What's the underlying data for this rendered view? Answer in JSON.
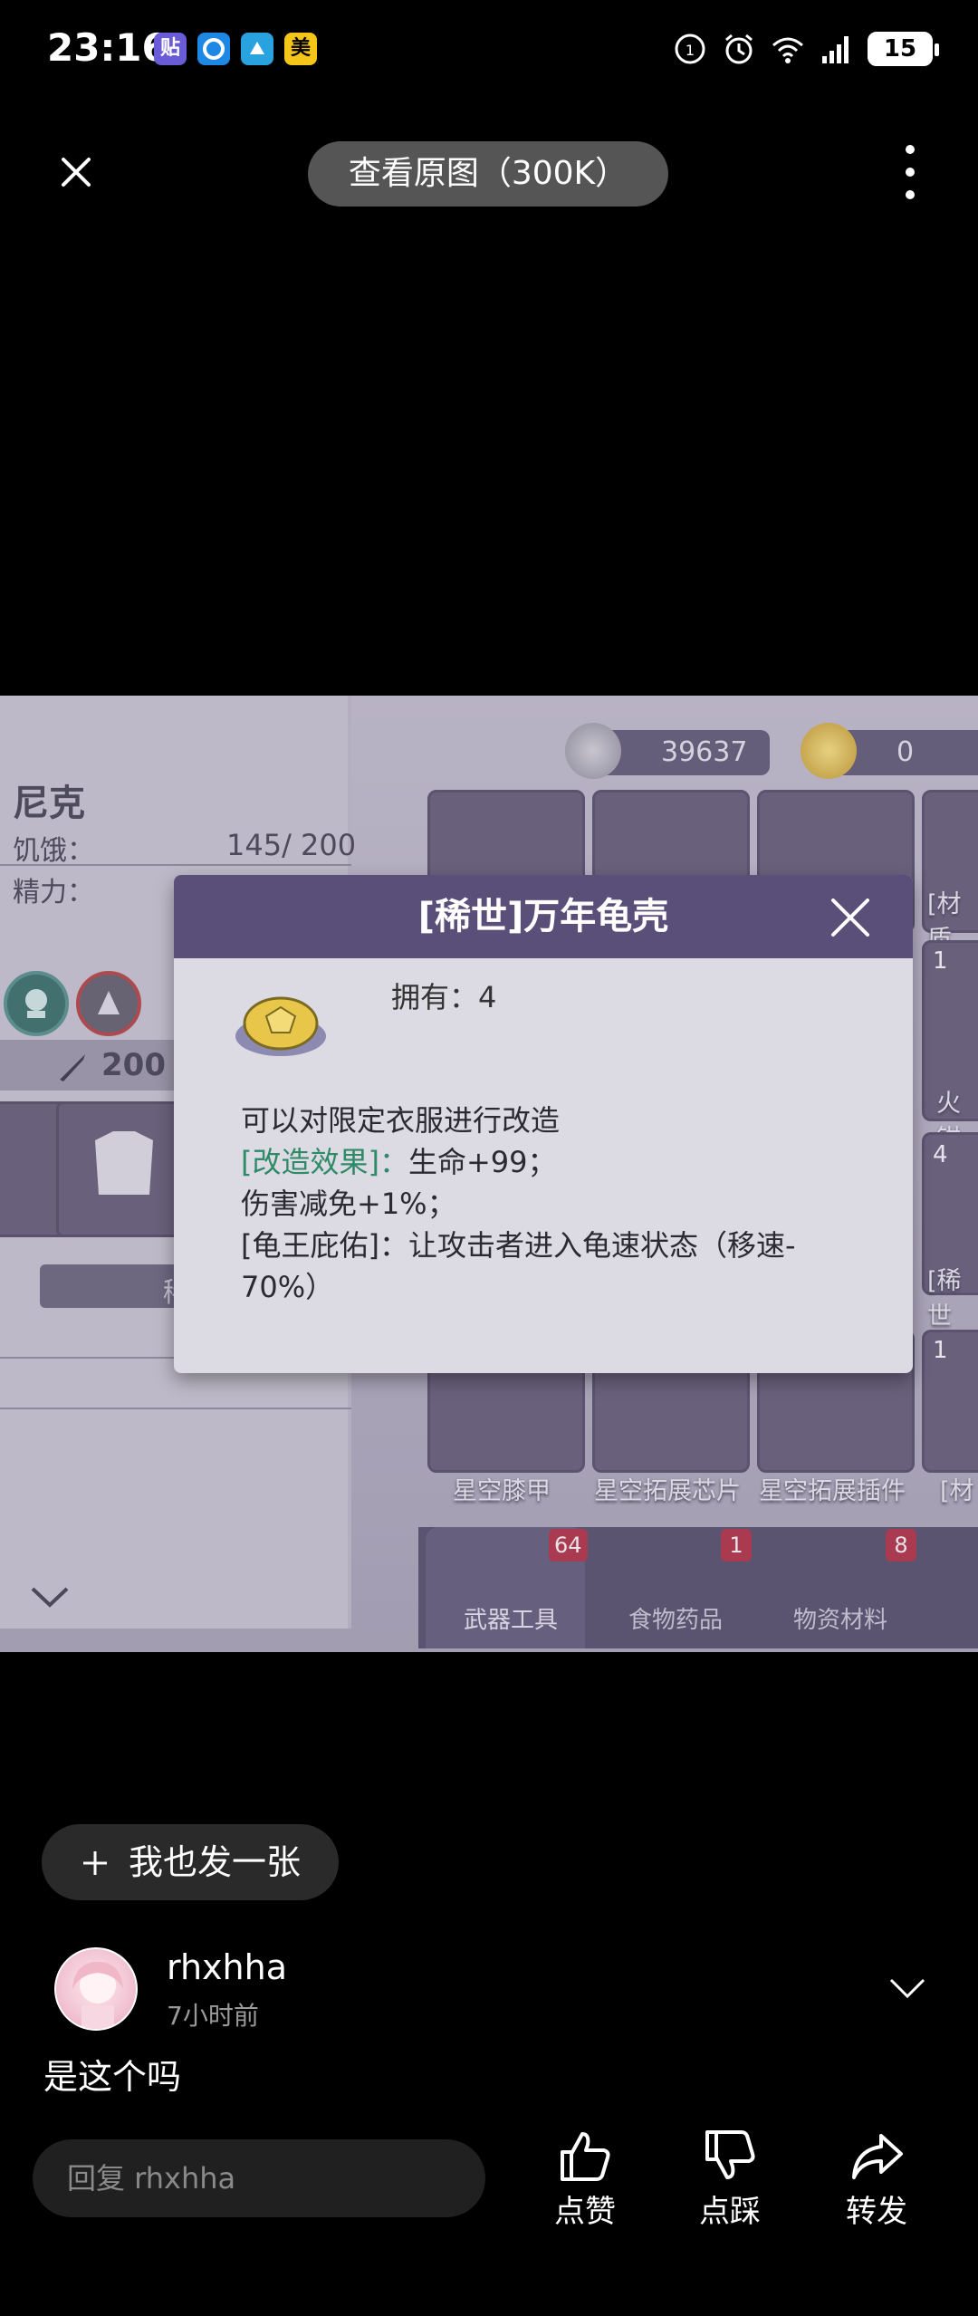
{
  "status_bar": {
    "time": "23:16",
    "app_icons": [
      "贴",
      "",
      "",
      "美"
    ],
    "battery": "15"
  },
  "top_nav": {
    "view_original": "查看原图（300K）"
  },
  "game": {
    "character_name": "尼克",
    "hunger_label": "饥饿：",
    "hunger_value": "145/ 200",
    "energy_label": "精力：",
    "attack_value": "200",
    "currency_silver": "39637",
    "currency_gold": "0",
    "grid_counts": [
      "1",
      "4",
      "1"
    ],
    "grid_labels_right": [
      "[材质",
      "火钳",
      "[稀世",
      "[材"
    ],
    "grid_labels_bottom": [
      "星空膝甲",
      "星空拓展芯片",
      "星空拓展插件"
    ],
    "tabs": [
      {
        "label": "武器工具",
        "badge": "64"
      },
      {
        "label": "食物药品",
        "badge": "1"
      },
      {
        "label": "物资材料",
        "badge": "8"
      }
    ],
    "partial_label_mid": "稀"
  },
  "dialog": {
    "title": "[稀世]万年龟壳",
    "own": "拥有：4",
    "line1": "可以对限定衣服进行改造",
    "line2_green": "[改造效果]：",
    "line2_rest": "生命+99；",
    "line3": "伤害减免+1%；",
    "line4": "[龟王庇佑]：让攻击者进入龟速状态（移速-",
    "line5": "70%）"
  },
  "post": {
    "post_button": "我也发一张",
    "username": "rhxhha",
    "time": "7小时前",
    "comment": "是这个吗",
    "reply_placeholder": "回复 rhxhha",
    "like": "点赞",
    "dislike": "点踩",
    "share": "转发"
  },
  "colors": {
    "background": "#000000",
    "dialog_header": "#5a4f78",
    "green_text": "#2f8a67",
    "badge_red": "#b3263a"
  },
  "icons": [
    "close-icon",
    "more-icon",
    "plus-icon",
    "chevron-down-icon",
    "thumbs-up-icon",
    "thumbs-down-icon",
    "share-icon"
  ]
}
